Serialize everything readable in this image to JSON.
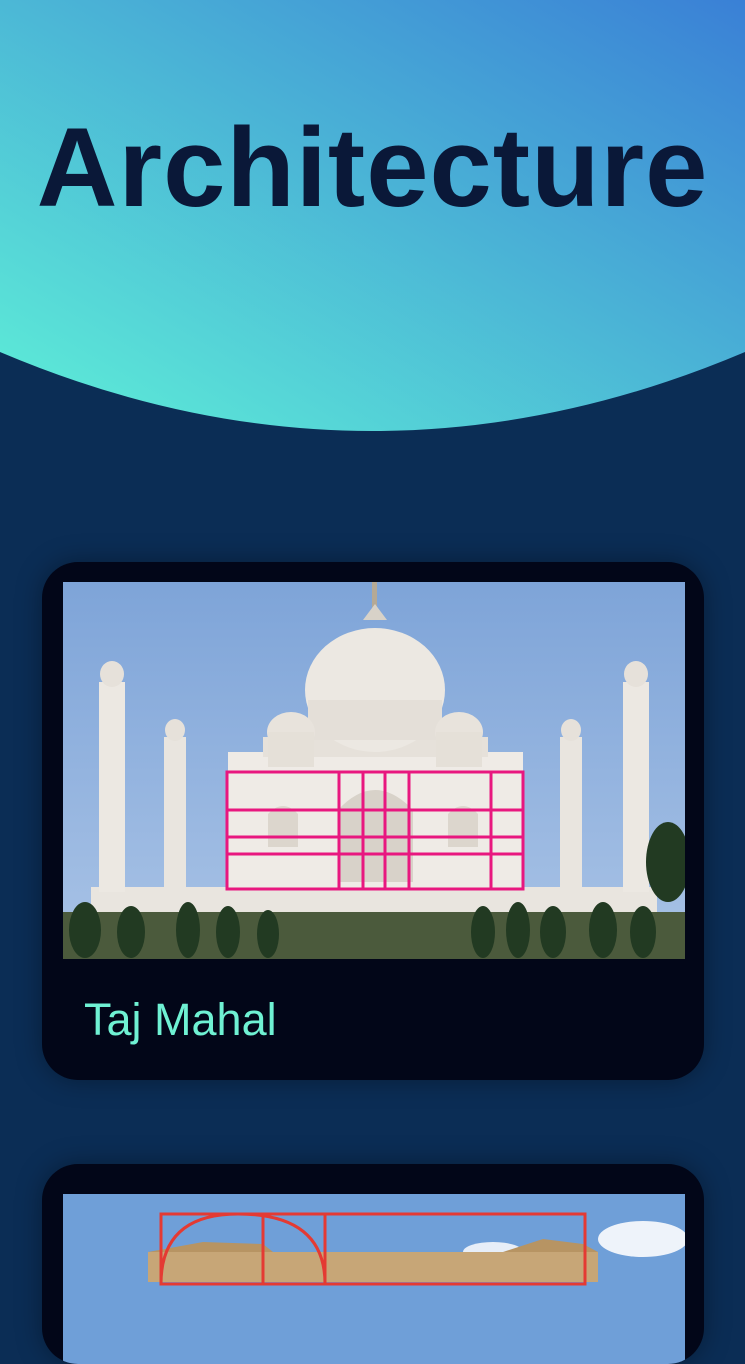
{
  "header": {
    "title": "Architecture",
    "gradient_start": "#5ef0d7",
    "gradient_end": "#3a80d6"
  },
  "cards": [
    {
      "label": "Taj Mahal",
      "image": "taj-mahal-golden-ratio-photo"
    },
    {
      "label": "",
      "image": "parthenon-golden-ratio-photo"
    }
  ],
  "colors": {
    "background": "#0b2d55",
    "card": "#020618",
    "label": "#6ff1d3",
    "overlay": "#e8177f"
  }
}
